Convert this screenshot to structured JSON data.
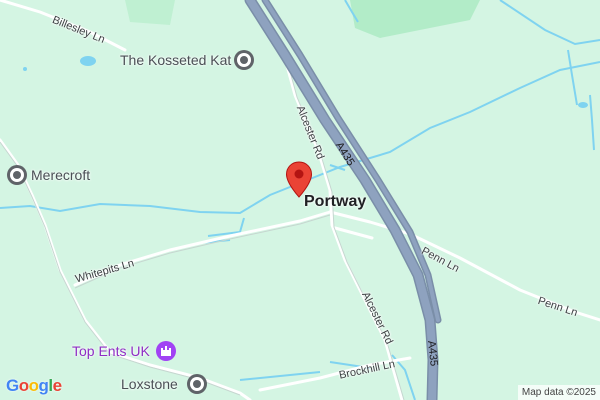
{
  "map": {
    "town": "Portway",
    "roads": {
      "billesley": "Billesley Ln",
      "alcester_upper": "Alcester Rd",
      "alcester_lower": "Alcester Rd",
      "whitepits": "Whitepits Ln",
      "penn_upper": "Penn Ln",
      "penn_lower": "Penn Ln",
      "brockhill": "Brockhill Ln",
      "a435_upper": "A435",
      "a435_lower": "A435"
    },
    "places": {
      "kosseted_kat": "The Kosseted Kat",
      "merecroft": "Merecroft",
      "top_ents": "Top Ents UK",
      "loxstone": "Loxstone"
    },
    "icons": {
      "marker": "red-location-pin",
      "generic_poi": "circle-dot-poi",
      "entertainment_poi": "castle-poi"
    },
    "colors": {
      "land": "#d4f5e3",
      "park": "#b2ecc8",
      "water": "#7fd3f0",
      "highway": "#8ea2bf",
      "road": "#ffffff",
      "pin": "#ea4335",
      "entertainment": "#a142f4"
    },
    "logo": "Google",
    "attribution": "Map data ©2025"
  }
}
